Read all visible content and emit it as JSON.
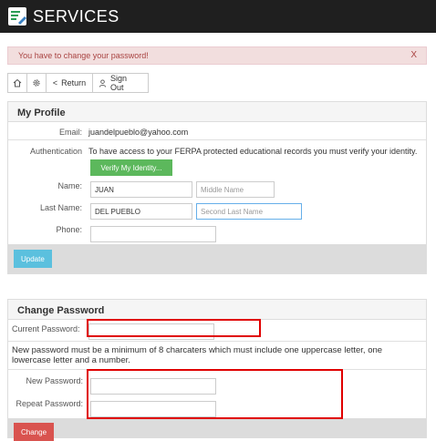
{
  "header": {
    "title": "SERVICES"
  },
  "alert": {
    "message": "You have to change your password!",
    "close": "X"
  },
  "toolbar": {
    "return_label": "Return",
    "signout_label": "Sign Out"
  },
  "profile": {
    "heading": "My Profile",
    "email_label": "Email:",
    "email_value": "juandelpueblo@yahoo.com",
    "auth_label": "Authentication",
    "auth_text": "To have access to your FERPA protected educational records you must verify your identity.",
    "verify_button": "Verify My Identity...",
    "name_label": "Name:",
    "first_name": "JUAN",
    "middle_placeholder": "Middle Name",
    "lastname_label": "Last Name:",
    "last_name": "DEL PUEBLO",
    "second_last_placeholder": "Second Last Name",
    "phone_label": "Phone:",
    "phone_value": "",
    "update_button": "Update"
  },
  "password": {
    "heading": "Change Password",
    "current_label": "Current Password:",
    "rule_text": "New password must be a minimum of 8 charcaters which must include one uppercase letter, one lowercase letter and a number.",
    "new_label": "New Password:",
    "repeat_label": "Repeat Password:",
    "change_button": "Change"
  }
}
